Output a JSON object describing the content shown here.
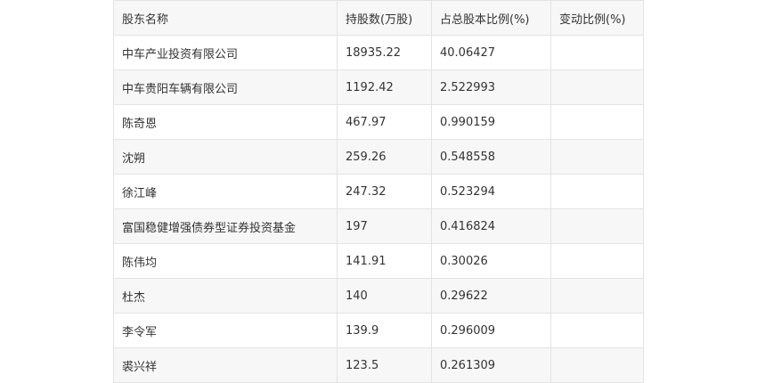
{
  "table": {
    "headers": [
      "股东名称",
      "持股数(万股)",
      "占总股本比例(%)",
      "变动比例(%)"
    ],
    "rows": [
      [
        "中车产业投资有限公司",
        "18935.22",
        "40.06427",
        ""
      ],
      [
        "中车贵阳车辆有限公司",
        "1192.42",
        "2.522993",
        ""
      ],
      [
        "陈奇恩",
        "467.97",
        "0.990159",
        ""
      ],
      [
        "沈朔",
        "259.26",
        "0.548558",
        ""
      ],
      [
        "徐江峰",
        "247.32",
        "0.523294",
        ""
      ],
      [
        "富国稳健增强债券型证券投资基金",
        "197",
        "0.416824",
        ""
      ],
      [
        "陈伟均",
        "141.91",
        "0.30026",
        ""
      ],
      [
        "杜杰",
        "140",
        "0.29622",
        ""
      ],
      [
        "李令军",
        "139.9",
        "0.296009",
        ""
      ],
      [
        "裘兴祥",
        "123.5",
        "0.261309",
        ""
      ]
    ]
  }
}
